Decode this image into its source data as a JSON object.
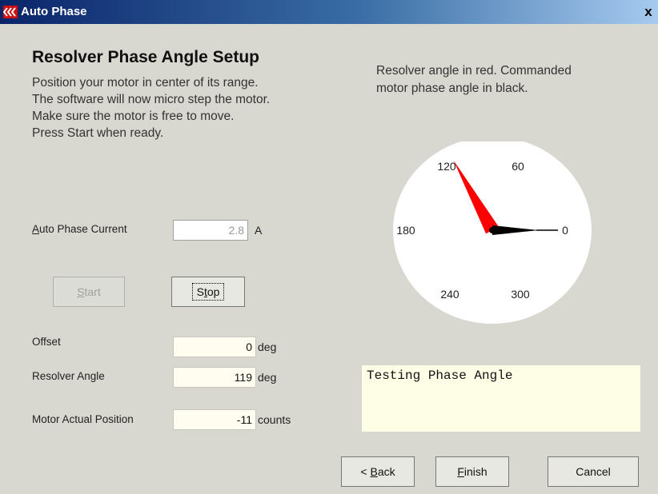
{
  "window": {
    "title": "Auto Phase",
    "close_glyph": "x"
  },
  "heading": "Resolver Phase Angle Setup",
  "instructions": [
    "Position your motor in center of its range.",
    "The software will now micro step the motor.",
    "Make sure the motor is free to move.",
    "Press Start when ready."
  ],
  "dial_caption": [
    "Resolver angle in red.  Commanded",
    "motor phase angle in black."
  ],
  "dial": {
    "labels": {
      "a120": "120",
      "a60": "60",
      "a180": "180",
      "a0": "0",
      "a240": "240",
      "a300": "300"
    },
    "resolver_angle_deg": 119,
    "commanded_angle_deg": 0,
    "resolver_color": "#ff0000",
    "commanded_color": "#000000"
  },
  "current": {
    "label_pre": "",
    "label_underline": "A",
    "label_rest": "uto Phase Current",
    "value": "2.8",
    "unit": "A"
  },
  "buttons": {
    "start": {
      "ul": "S",
      "rest": "tart"
    },
    "stop": {
      "pre": "S",
      "ul": "t",
      "rest": "op"
    },
    "back": {
      "pre": "< ",
      "ul": "B",
      "rest": "ack"
    },
    "finish": {
      "ul": "F",
      "rest": "inish"
    },
    "cancel": "Cancel"
  },
  "readouts": {
    "offset": {
      "label": "Offset",
      "value": "0",
      "unit": "deg"
    },
    "resolver_angle": {
      "label": "Resolver Angle",
      "value": "119",
      "unit": "deg"
    },
    "motor_position": {
      "label": "Motor Actual Position",
      "value": "-11",
      "unit": "counts"
    }
  },
  "status": "Testing Phase Angle"
}
